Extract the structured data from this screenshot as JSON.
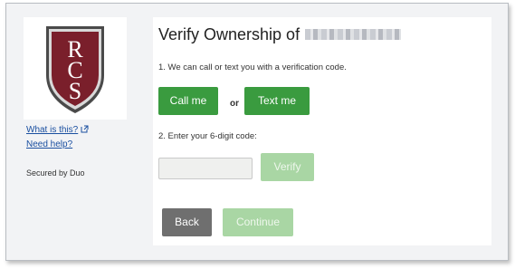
{
  "sidebar": {
    "logo_letters": "RCS",
    "links": [
      {
        "label": "What is this?"
      },
      {
        "label": "Need help?"
      }
    ],
    "secured_by": "Secured by Duo"
  },
  "main": {
    "title": "Verify Ownership of",
    "step1": "1. We can call or text you with a verification code.",
    "call_label": "Call me",
    "or_label": "or",
    "text_label": "Text me",
    "step2": "2. Enter your 6-digit code:",
    "code_value": "",
    "verify_label": "Verify",
    "back_label": "Back",
    "continue_label": "Continue"
  },
  "colors": {
    "primary_green": "#3a9b3f",
    "disabled_green": "#a9d6a4",
    "back_gray": "#6f6f6f",
    "link_blue": "#1a4fa0",
    "logo_maroon": "#7a1f2b"
  },
  "icons": {
    "external_link": "external-link-icon"
  }
}
